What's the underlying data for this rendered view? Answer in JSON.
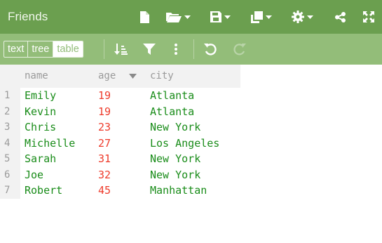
{
  "window": {
    "title": "Friends"
  },
  "titlebar": {
    "icons": [
      "new-document-icon",
      "open-folder-icon",
      "save-icon",
      "copy-icon",
      "settings-icon",
      "share-icon",
      "fullscreen-icon"
    ]
  },
  "toolbar": {
    "modes": [
      {
        "label": "text",
        "active": false
      },
      {
        "label": "tree",
        "active": false
      },
      {
        "label": "table",
        "active": true
      }
    ],
    "icons": [
      "sort-icon",
      "filter-icon",
      "more-icon",
      "undo-icon",
      "redo-icon"
    ]
  },
  "table": {
    "columns": [
      {
        "label": "name"
      },
      {
        "label": "age",
        "sorted": "descending-indicator"
      },
      {
        "label": "city"
      }
    ],
    "rows": [
      {
        "num": "1",
        "name": "Emily",
        "age": "19",
        "city": "Atlanta"
      },
      {
        "num": "2",
        "name": "Kevin",
        "age": "19",
        "city": "Atlanta"
      },
      {
        "num": "3",
        "name": "Chris",
        "age": "23",
        "city": "New York"
      },
      {
        "num": "4",
        "name": "Michelle",
        "age": "27",
        "city": "Los Angeles"
      },
      {
        "num": "5",
        "name": "Sarah",
        "age": "31",
        "city": "New York"
      },
      {
        "num": "6",
        "name": "Joe",
        "age": "32",
        "city": "New York"
      },
      {
        "num": "7",
        "name": "Robert",
        "age": "45",
        "city": "Manhattan"
      }
    ]
  },
  "colors": {
    "titlebar": "#6b9f4f",
    "toolbar": "#93bd79",
    "string_value": "#198c19",
    "number_value": "#ee3b2b",
    "muted": "#9a9a9a"
  }
}
